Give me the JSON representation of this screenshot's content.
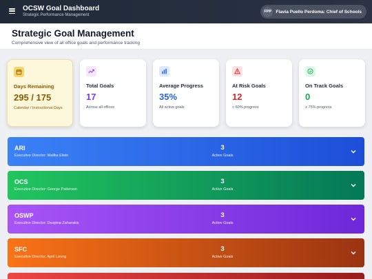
{
  "app": {
    "title": "OCSW Goal Dashboard",
    "subtitle": "Strategic Performance Management",
    "user_initials": "FPP",
    "user_name": "Flavia Puello Perdoma: Chief of Schools"
  },
  "page": {
    "title": "Strategic Goal Management",
    "subtitle": "Comprehensive view of all office goals and performance tracking"
  },
  "stats": [
    {
      "label": "Days Remaining",
      "value": "295 / 175",
      "desc": "Calendar / Instructional Days",
      "icon": "calendar-icon",
      "color": "#8a5a00"
    },
    {
      "label": "Total Goals",
      "value": "17",
      "desc": "Across all offices",
      "icon": "trending-up-icon",
      "color": "#7c3aed"
    },
    {
      "label": "Average Progress",
      "value": "35%",
      "desc": "All active goals",
      "icon": "bar-chart-icon",
      "color": "#2563eb"
    },
    {
      "label": "At Risk Goals",
      "value": "12",
      "desc": "< 60% progress",
      "icon": "warning-icon",
      "color": "#dc2626"
    },
    {
      "label": "On Track Goals",
      "value": "0",
      "desc": "≥ 75% progress",
      "icon": "check-circle-icon",
      "color": "#16a34a"
    }
  ],
  "offices": [
    {
      "code": "ARI",
      "director": "Executive Director: Mallka Elwin",
      "count": "3",
      "count_label": "Active Goals"
    },
    {
      "code": "OCS",
      "director": "Executive Director: George Patterson",
      "count": "3",
      "count_label": "Active Goals"
    },
    {
      "code": "OSWP",
      "director": "Executive Director: Despina Zaharakis",
      "count": "3",
      "count_label": "Active Goals"
    },
    {
      "code": "SFC",
      "director": "Executive Director: April Leong",
      "count": "3",
      "count_label": "Active Goals"
    }
  ],
  "colors": {
    "ari": [
      "#3b82f6",
      "#1d4ed8"
    ],
    "ocs": [
      "#22c55e",
      "#047857"
    ],
    "oswp": [
      "#a855f7",
      "#6d28d9"
    ],
    "sfc": [
      "#f97316",
      "#9a3412"
    ],
    "fifth": [
      "#ef4444",
      "#991b1b"
    ]
  }
}
